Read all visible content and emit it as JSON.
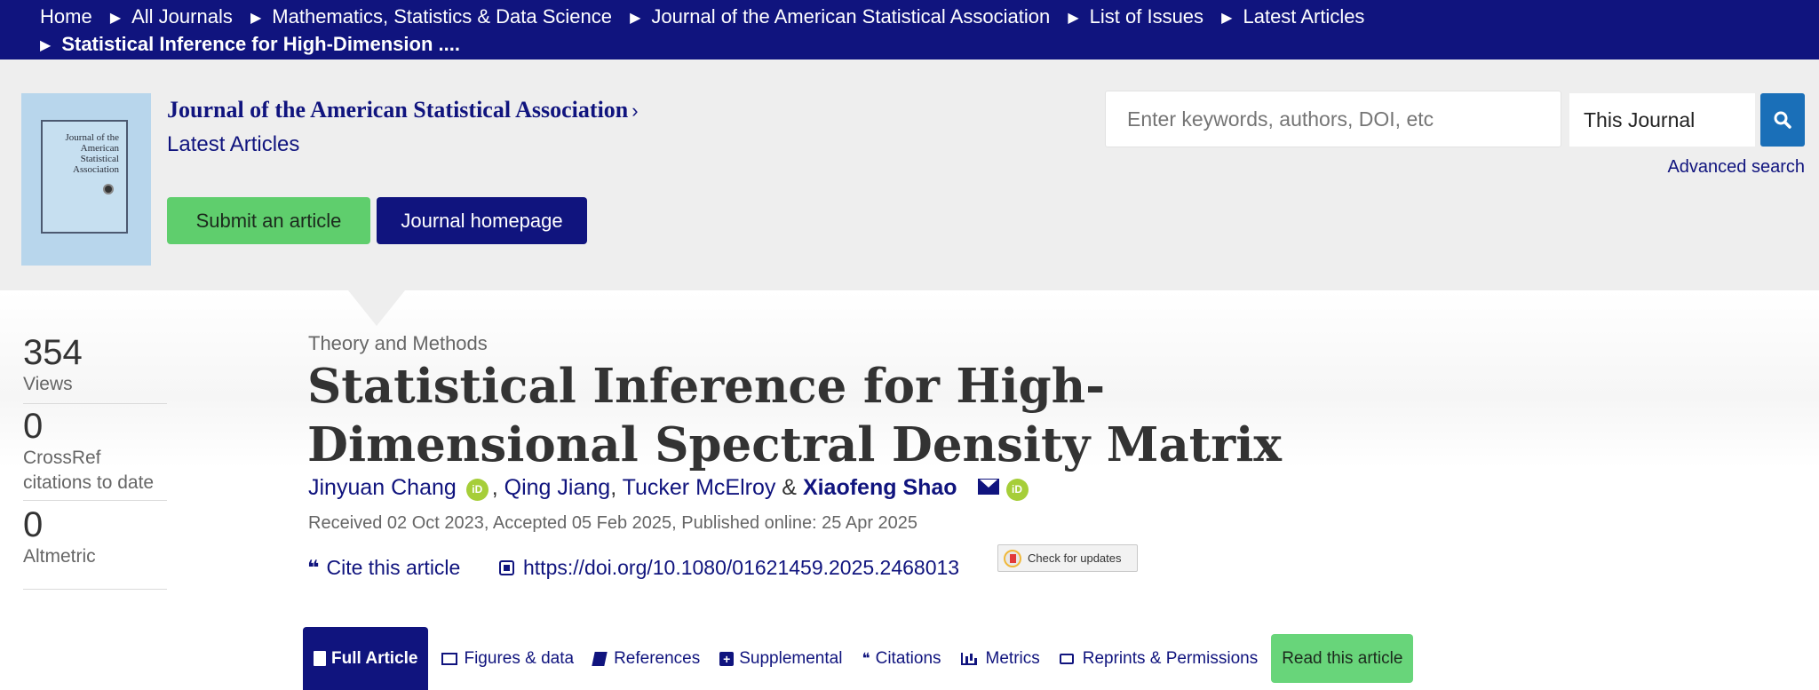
{
  "breadcrumb": {
    "items": [
      "Home",
      "All Journals",
      "Mathematics, Statistics & Data Science",
      "Journal of the American Statistical Association",
      "List of Issues",
      "Latest Articles",
      "Statistical Inference for High-Dimension ...."
    ]
  },
  "journal": {
    "cover_title": "Journal of the American Statistical Association",
    "title": "Journal of the American Statistical Association",
    "subtitle": "Latest Articles",
    "submit_label": "Submit an article",
    "homepage_label": "Journal homepage"
  },
  "search": {
    "placeholder": "Enter keywords, authors, DOI, etc",
    "scope": "This Journal",
    "advanced_label": "Advanced search"
  },
  "metrics": [
    {
      "value": "354",
      "label": "Views"
    },
    {
      "value": "0",
      "label": "CrossRef citations to date"
    },
    {
      "value": "0",
      "label": "Altmetric"
    }
  ],
  "article": {
    "section": "Theory and Methods",
    "title": "Statistical Inference for High-Dimensional Spectral Density Matrix",
    "authors": [
      "Jinyuan Chang",
      "Qing Jiang",
      "Tucker McElroy",
      "Xiaofeng Shao"
    ],
    "dates": "Received 02 Oct 2023, Accepted 05 Feb 2025, Published online: 25 Apr 2025",
    "cite_label": "Cite this article",
    "doi": "https://doi.org/10.1080/01621459.2025.2468013",
    "check_updates_label": "Check for updates"
  },
  "tabs": {
    "full_article": "Full Article",
    "figures": "Figures & data",
    "references": "References",
    "supplemental": "Supplemental",
    "citations": "Citations",
    "metrics": "Metrics",
    "reprints": "Reprints & Permissions",
    "read": "Read this article"
  },
  "colors": {
    "brand_navy": "#10147e",
    "accent_green": "#5fce6d",
    "search_blue": "#1a6fb8",
    "orcid_green": "#a6ce39"
  }
}
